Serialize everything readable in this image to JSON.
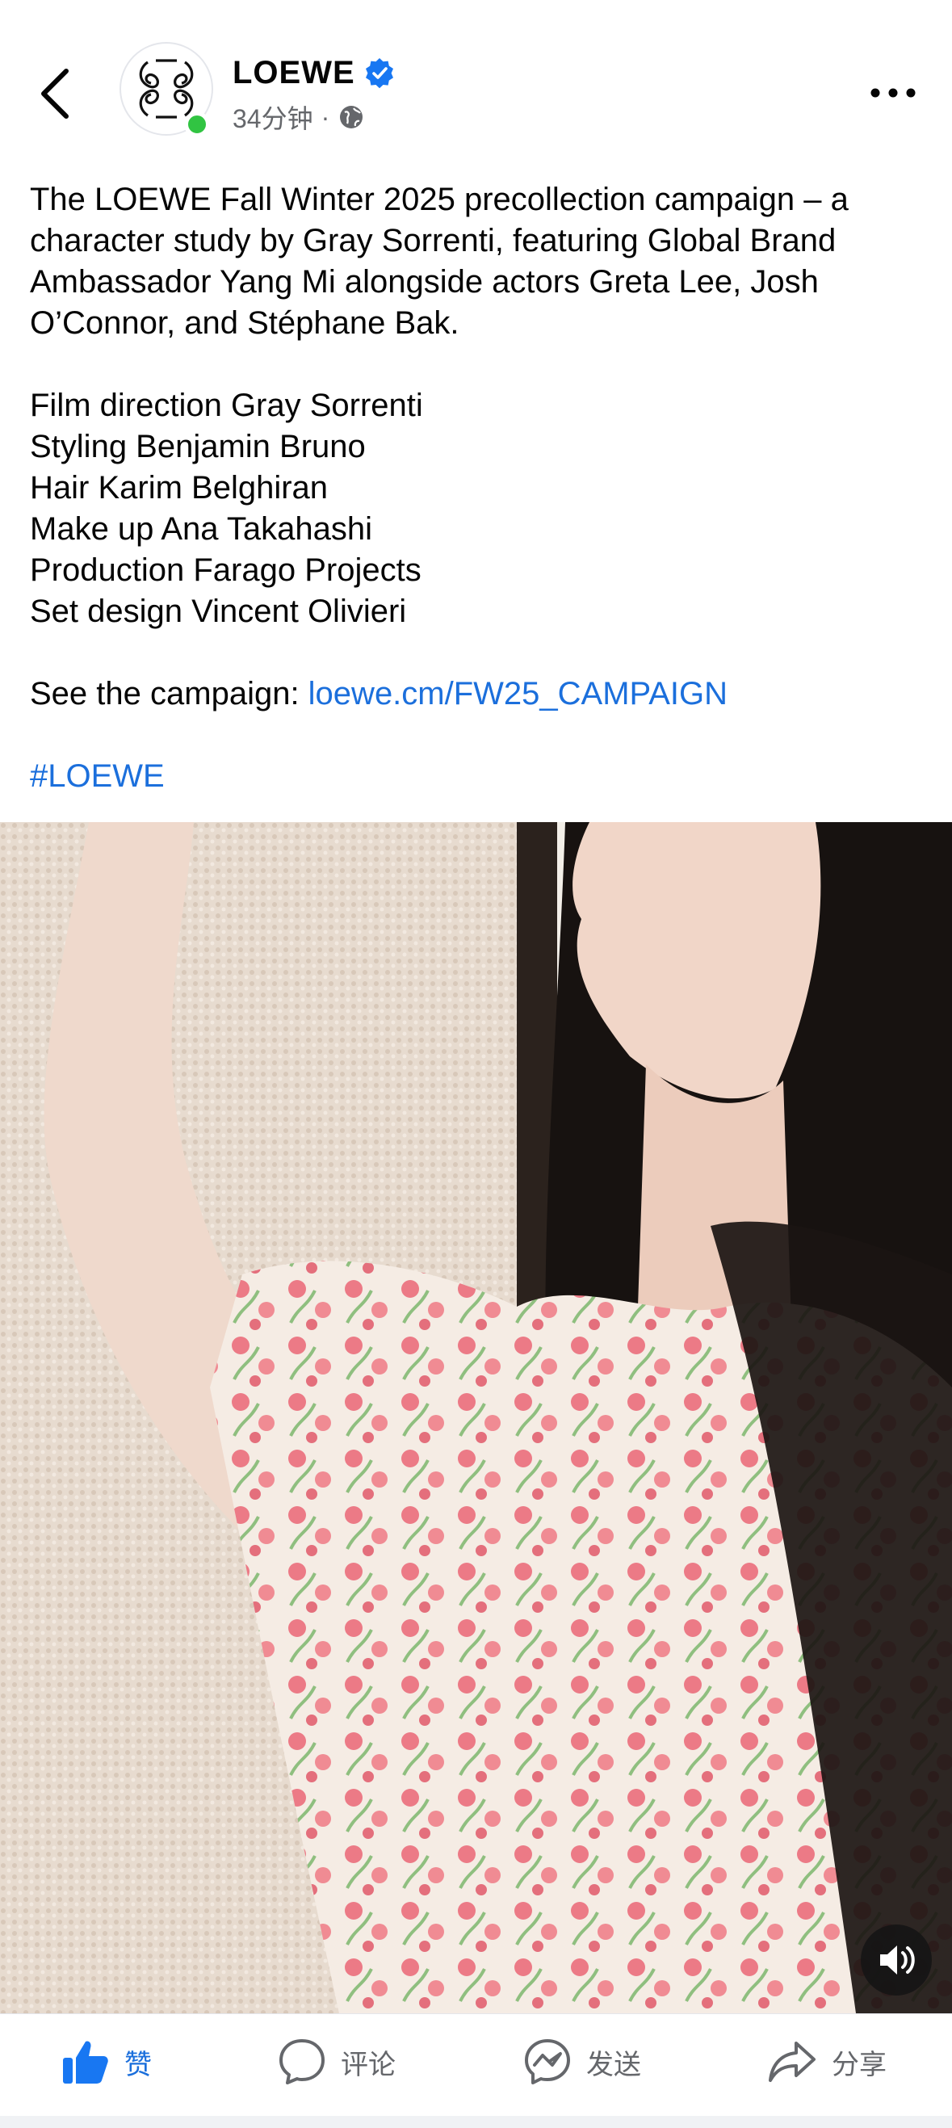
{
  "header": {
    "page_name": "LOEWE",
    "verified": true,
    "time_ago": "34分钟",
    "separator": "·",
    "icons": {
      "back": "chevron-left-icon",
      "globe": "globe-icon",
      "more": "more-horizontal-icon",
      "verified": "verified-badge-icon"
    },
    "colors": {
      "verified": "#1877f2",
      "online": "#31c442"
    }
  },
  "post": {
    "lines": [
      "The LOEWE Fall Winter 2025 precollection campaign – a",
      "character study by Gray Sorrenti, featuring Global Brand",
      "Ambassador Yang Mi alongside actors Greta Lee, Josh",
      "O’Connor, and Stéphane Bak."
    ],
    "credits": [
      "Film direction Gray Sorrenti",
      "Styling Benjamin Bruno",
      "Hair Karim Belghiran",
      "Make up Ana Takahashi",
      "Production Farago Projects",
      "Set design Vincent Olivieri"
    ],
    "campaign_prefix": "See the campaign: ",
    "campaign_link": "loewe.cm/FW25_CAMPAIGN",
    "hashtag": "#LOEWE",
    "link_color": "#1b6fdc"
  },
  "media": {
    "type": "video",
    "mute_icon": "volume-icon"
  },
  "actions": {
    "like": "赞",
    "comment": "评论",
    "send": "发送",
    "share": "分享",
    "like_color": "#1b6fdc"
  }
}
